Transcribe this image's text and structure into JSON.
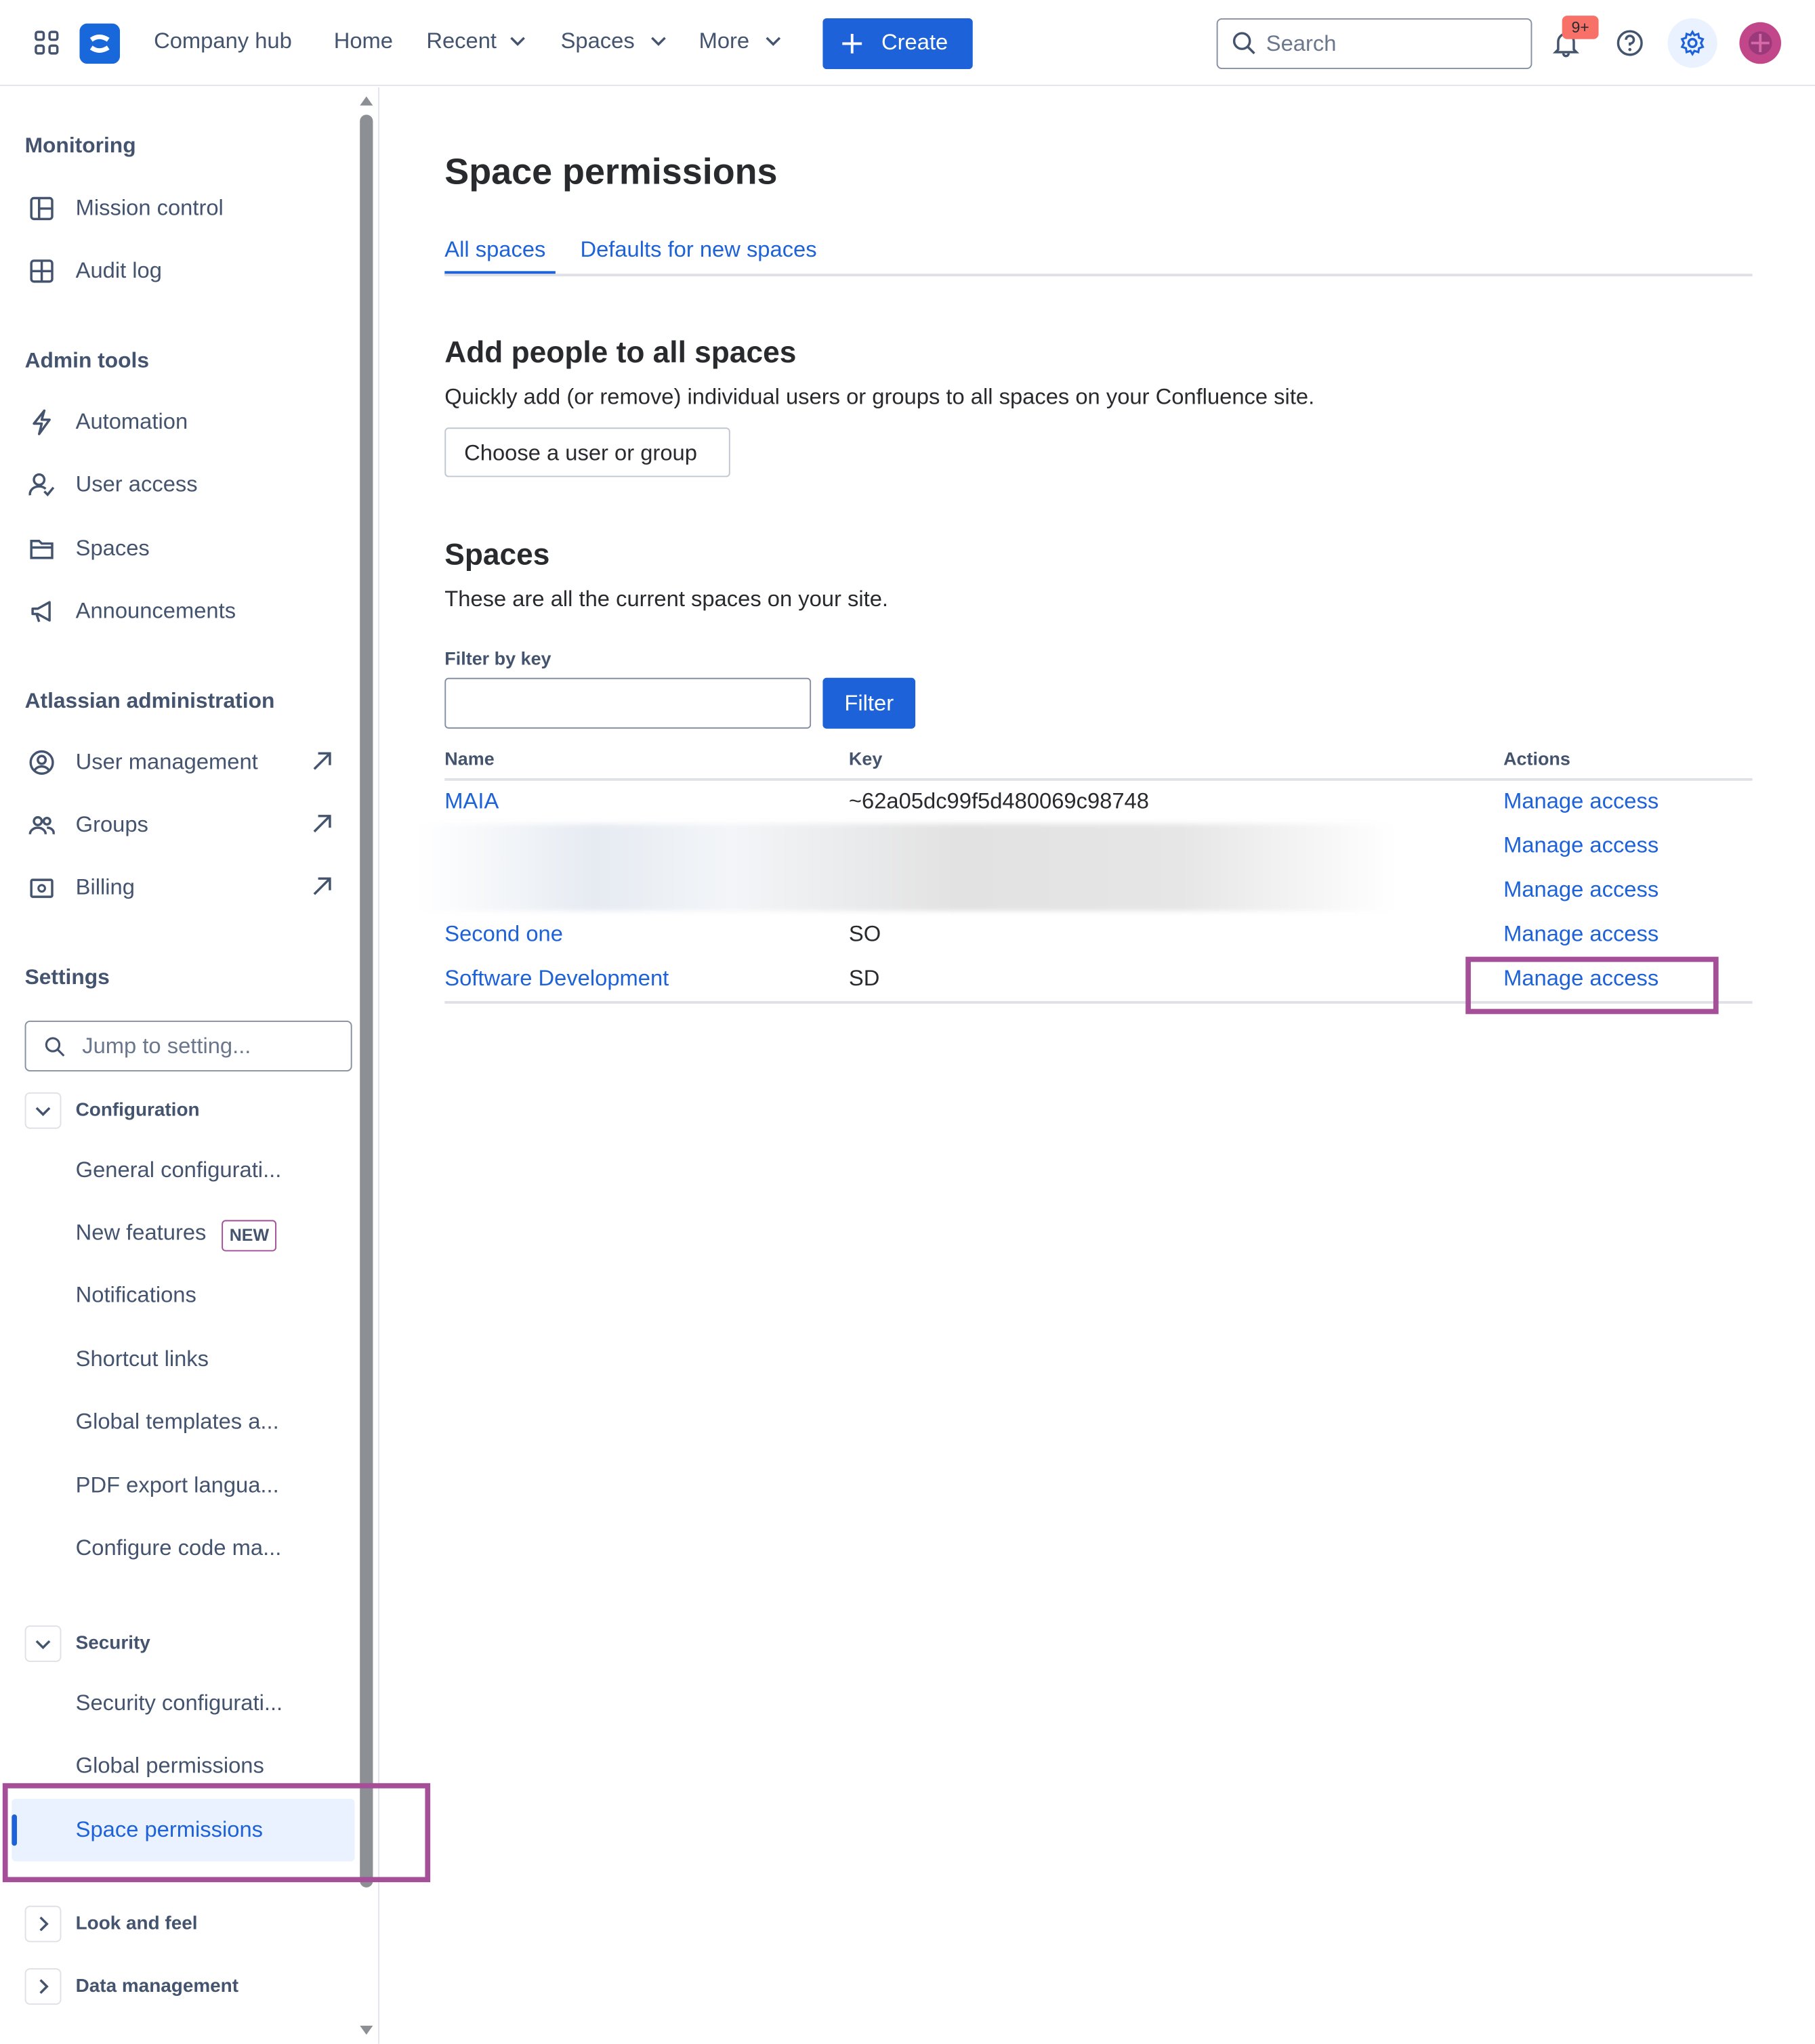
{
  "topbar": {
    "site_name": "Company hub",
    "nav": [
      {
        "label": "Home"
      },
      {
        "label": "Recent"
      },
      {
        "label": "Spaces"
      },
      {
        "label": "More"
      }
    ],
    "create_label": "Create",
    "search_placeholder": "Search",
    "notifications_badge": "9+"
  },
  "sidebar": {
    "sections": [
      {
        "heading": "Monitoring",
        "items": [
          {
            "label": "Mission control",
            "icon": "dashboard-icon"
          },
          {
            "label": "Audit log",
            "icon": "grid-icon"
          }
        ]
      },
      {
        "heading": "Admin tools",
        "items": [
          {
            "label": "Automation",
            "icon": "lightning-icon"
          },
          {
            "label": "User access",
            "icon": "user-check-icon"
          },
          {
            "label": "Spaces",
            "icon": "folder-icon"
          },
          {
            "label": "Announcements",
            "icon": "megaphone-icon"
          }
        ]
      },
      {
        "heading": "Atlassian administration",
        "items": [
          {
            "label": "User management",
            "icon": "user-circle-icon"
          },
          {
            "label": "Groups",
            "icon": "people-icon"
          },
          {
            "label": "Billing",
            "icon": "billing-icon"
          }
        ]
      },
      {
        "heading": "Settings"
      }
    ],
    "jump_placeholder": "Jump to setting...",
    "configuration": {
      "label": "Configuration",
      "items": [
        "General configurati...",
        "New features",
        "Notifications",
        "Shortcut links",
        "Global templates a...",
        "PDF export langua...",
        "Configure code ma..."
      ],
      "new_badge": "NEW"
    },
    "security": {
      "label": "Security",
      "items": [
        "Security configurati...",
        "Global permissions",
        "Space permissions"
      ]
    },
    "look_and_feel": "Look and feel",
    "data_management": "Data management"
  },
  "main": {
    "title": "Space permissions",
    "tabs": [
      "All spaces",
      "Defaults for new spaces"
    ],
    "add_people": {
      "heading": "Add people to all spaces",
      "description": "Quickly add (or remove) individual users or groups to all spaces on your Confluence site.",
      "button_label": "Choose a user or group"
    },
    "spaces": {
      "heading": "Spaces",
      "description": "These are all the current spaces on your site.",
      "filter_label": "Filter by key",
      "filter_value": "",
      "filter_button": "Filter",
      "columns": [
        "Name",
        "Key",
        "Actions"
      ],
      "rows": [
        {
          "name": "MAIA",
          "key": "~62a05dc99f5d480069c98748",
          "action": "Manage access"
        },
        {
          "name": "",
          "key": "",
          "action": "Manage access"
        },
        {
          "name": "",
          "key": "",
          "action": "Manage access"
        },
        {
          "name": "Second one",
          "key": "SO",
          "action": "Manage access"
        },
        {
          "name": "Software Development",
          "key": "SD",
          "action": "Manage access"
        }
      ]
    }
  },
  "colors": {
    "brand": "#1d62d9",
    "highlight": "#a54f99",
    "badge": "#f87168"
  }
}
